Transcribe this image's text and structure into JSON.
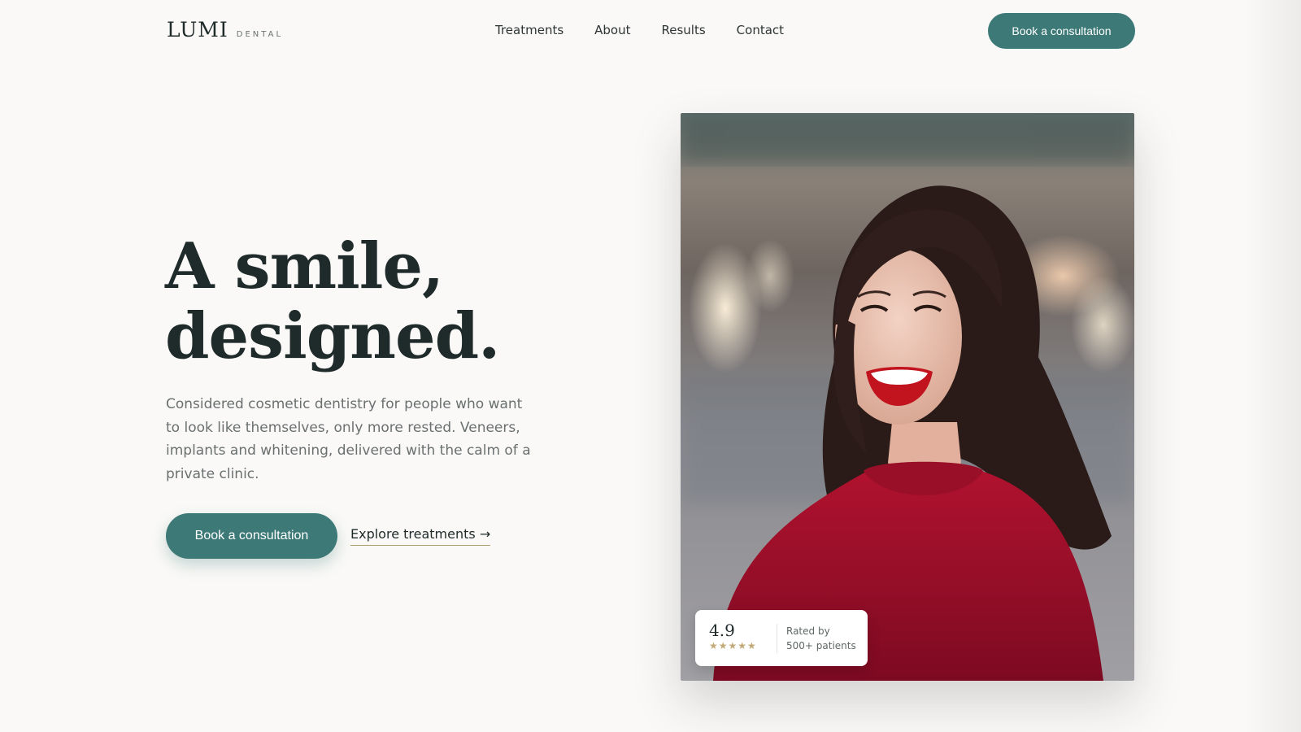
{
  "brand": {
    "name": "LUMI",
    "sub": "DENTAL"
  },
  "nav": {
    "links": [
      "Treatments",
      "About",
      "Results",
      "Contact"
    ],
    "cta": "Book a consultation"
  },
  "hero": {
    "title_line1": "A smile,",
    "title_line2": "designed.",
    "description": "Considered cosmetic dentistry for people who want to look like themselves, only more rested. Veneers, implants and whitening, delivered with the calm of a private clinic.",
    "primary_cta": "Book a consultation",
    "secondary_cta": "Explore treatments →"
  },
  "rating": {
    "score": "4.9",
    "stars": "★★★★★",
    "label_line1": "Rated by",
    "label_line2": "500+ patients"
  },
  "colors": {
    "accent": "#3d7a77",
    "background": "#faf9f7",
    "text": "#1f2a2a",
    "star": "#c2a977"
  }
}
